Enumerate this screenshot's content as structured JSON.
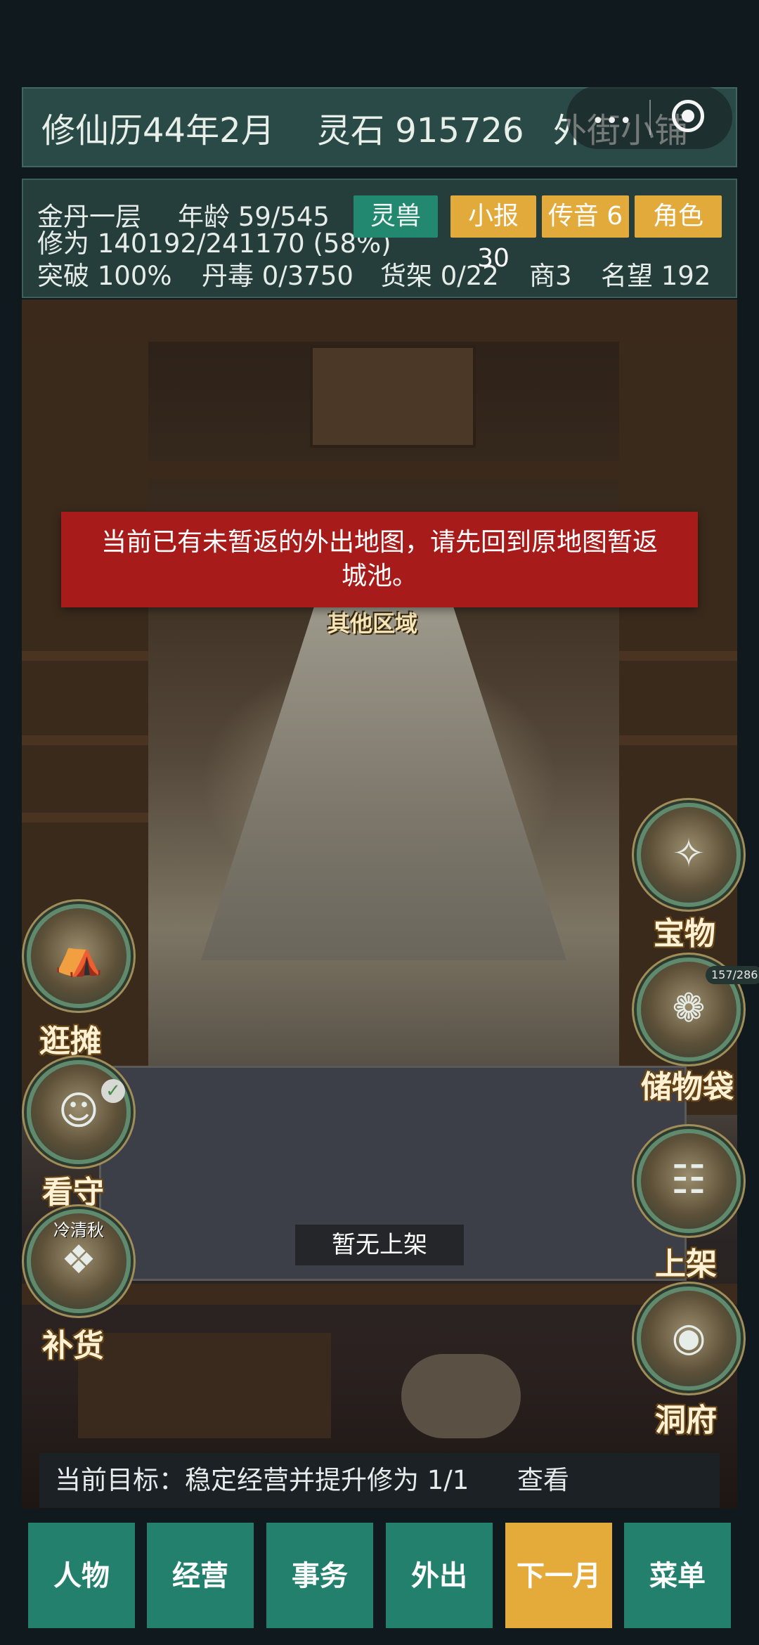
{
  "header": {
    "date": "修仙历44年2月",
    "spirit_stone": "灵石 915726",
    "location": "外街小铺",
    "capsule_icon": "more-dots-icon"
  },
  "stats": {
    "realm": "金丹一层",
    "age": "年龄 59/545",
    "cultivation": "修为 140192/241170 (58%)",
    "breakthrough": "突破 100%",
    "pill_poison": "丹毒 0/3750",
    "shelf": "货架 0/22",
    "merchant": "商3",
    "reputation": "名望 192",
    "btn_beast": "灵兽",
    "btn_news": "小报 30",
    "btn_message": "传音 6",
    "btn_role": "角色"
  },
  "toast": {
    "message": "当前已有未暂返的外出地图，请先回到原地图暂返城池。"
  },
  "scene": {
    "zone_label": "其他区域",
    "shelf_status": "暂无上架",
    "left_buttons": [
      "逛摊",
      "看守",
      "补货"
    ],
    "restock_owner": "冷清秋",
    "right_buttons": [
      "宝物",
      "储物袋",
      "上架",
      "洞府"
    ],
    "bag_count": "157/286"
  },
  "goal": {
    "text": "当前目标：稳定经营并提升修为 1/1",
    "view": "查看"
  },
  "nav": [
    "人物",
    "经营",
    "事务",
    "外出",
    "下一月",
    "菜单"
  ],
  "colors": {
    "nav_green": "#22806c",
    "nav_highlight": "#e4aa3a",
    "toast_red": "#a71c1a",
    "panel_teal": "#2a4a47"
  }
}
